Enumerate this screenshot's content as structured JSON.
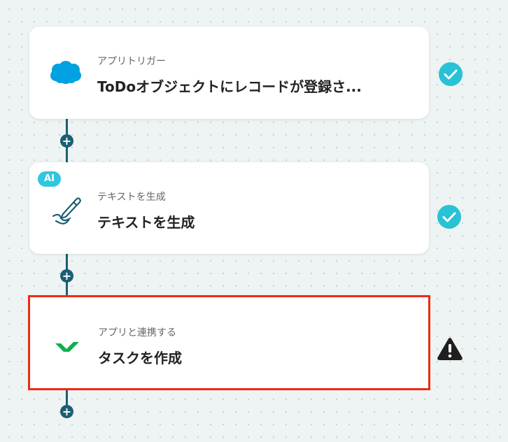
{
  "flow": {
    "steps": [
      {
        "subtitle": "アプリトリガー",
        "title": "ToDoオブジェクトにレコードが登録さ...",
        "icon": "salesforce-cloud-icon",
        "status": "check-icon"
      },
      {
        "badge": "AI",
        "subtitle": "テキストを生成",
        "title": "テキストを生成",
        "icon": "pen-icon",
        "status": "check-icon"
      },
      {
        "subtitle": "アプリと連携する",
        "title": "タスクを作成",
        "icon": "wrike-check-icon",
        "status": "warning-icon"
      }
    ],
    "add_step_symbol": "+",
    "colors": {
      "connector": "#1b5f73",
      "check": "#27c2d6",
      "selected_border": "#f02a10",
      "warning": "#1f1f1f"
    }
  }
}
